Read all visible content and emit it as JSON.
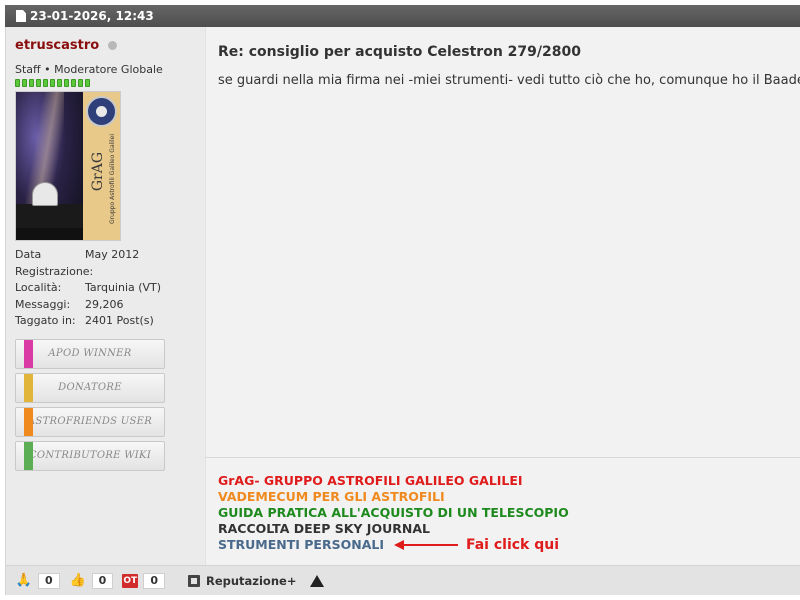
{
  "header": {
    "datetime": "23-01-2026, 12:43"
  },
  "user": {
    "username": "etruscastro",
    "title": "Staff • Moderatore Globale",
    "avatar": {
      "brand": "GrAG",
      "brand_sub": "Gruppo Astrofili Galileo Galilei"
    },
    "info": [
      {
        "label": "Data Registrazione:",
        "value": "May 2012"
      },
      {
        "label": "Località:",
        "value": "Tarquinia (VT)"
      },
      {
        "label": "Messaggi:",
        "value": "29,206"
      },
      {
        "label": "Taggato in:",
        "value": "2401 Post(s)"
      }
    ],
    "awards": [
      {
        "label": "APOD WINNER",
        "color": "#d93aa3"
      },
      {
        "label": "DONATORE",
        "color": "#e0b53a"
      },
      {
        "label": "ASTROFRIENDS USER",
        "color": "#f08a1f"
      },
      {
        "label": "CONTRIBUTORE WIKI",
        "color": "#5cae55"
      }
    ]
  },
  "post": {
    "title": "Re: consiglio per acquisto Celestron 279/2800",
    "body": "se guardi nella mia firma nei -miei strumenti- vedi tutto ciò che ho, comunque ho il Baader"
  },
  "signature": {
    "lines": [
      {
        "text": "GrAG- GRUPPO ASTROFILI GALILEO GALILEI",
        "color": "#e01b1b"
      },
      {
        "text": "VADEMECUM PER GLI ASTROFILI",
        "color": "#f08a1f"
      },
      {
        "text": "GUIDA PRATICA ALL'ACQUISTO DI UN TELESCOPIO",
        "color": "#1e8a1e"
      },
      {
        "text": "RACCOLTA DEEP SKY JOURNAL",
        "color": "#333333"
      },
      {
        "text": "STRUMENTI PERSONALI",
        "color": "#4a6a8c"
      }
    ],
    "click_hint": "Fai click qui"
  },
  "footer": {
    "reactions": [
      {
        "icon": "pray-icon",
        "count": "0"
      },
      {
        "icon": "thumbs-up-icon",
        "count": "0"
      },
      {
        "icon": "ot-icon",
        "label": "OT",
        "count": "0"
      }
    ],
    "reputation_label": "Reputazione+"
  }
}
